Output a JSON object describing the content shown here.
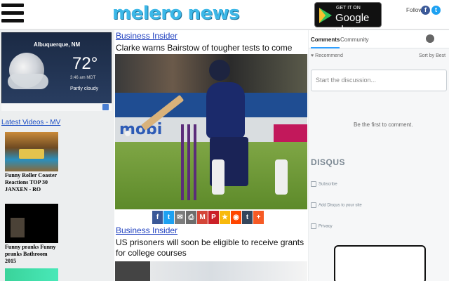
{
  "header": {
    "logo_text": "melero news",
    "gplay_small": "GET IT ON",
    "gplay_big": "Google play",
    "follow_label": "Follow",
    "facebook_glyph": "f",
    "twitter_glyph": "t"
  },
  "weather": {
    "city": "Albuquerque, NM",
    "temp": "72°",
    "time": "3:46 am MDT",
    "condition": "Partly cloudy"
  },
  "left": {
    "latest_videos": "Latest Videos - MV",
    "thumbs": [
      {
        "caption": "Funny Roller Coaster Reactions TOP 30 JANXEN - RO"
      },
      {
        "caption": "Funny pranks Funny pranks Bathroom 2015"
      }
    ]
  },
  "articles": [
    {
      "source": "Business Insider",
      "title": "Clarke warns Bairstow of tougher tests to come"
    },
    {
      "source": "Business Insider",
      "title": "US prisoners will soon be eligible to receive grants for college courses"
    }
  ],
  "photo": {
    "board_text": "mobi"
  },
  "share_buttons": [
    {
      "icon": "facebook-icon",
      "glyph": "f",
      "color": "#3b5998"
    },
    {
      "icon": "twitter-icon",
      "glyph": "t",
      "color": "#1da1f2"
    },
    {
      "icon": "email-icon",
      "glyph": "✉",
      "color": "#7c7c7c"
    },
    {
      "icon": "print-icon",
      "glyph": "⎙",
      "color": "#6d6d6d"
    },
    {
      "icon": "gmail-icon",
      "glyph": "M",
      "color": "#d44638"
    },
    {
      "icon": "pinterest-icon",
      "glyph": "P",
      "color": "#cb2027"
    },
    {
      "icon": "favorite-icon",
      "glyph": "★",
      "color": "#f8b90c"
    },
    {
      "icon": "reddit-icon",
      "glyph": "◉",
      "color": "#ff4500"
    },
    {
      "icon": "tumblr-icon",
      "glyph": "t",
      "color": "#35465c"
    },
    {
      "icon": "more-icon",
      "glyph": "+",
      "color": "#f65a25"
    }
  ],
  "disqus": {
    "tab_comments": "Comments",
    "tab_community": "Community",
    "recommend": "Recommend",
    "sort": "Sort by Best",
    "placeholder": "Start the discussion...",
    "empty": "Be the first to comment.",
    "brand": "DISQUS",
    "links": [
      "Subscribe",
      "Add Disqus to your site",
      "Privacy"
    ]
  }
}
